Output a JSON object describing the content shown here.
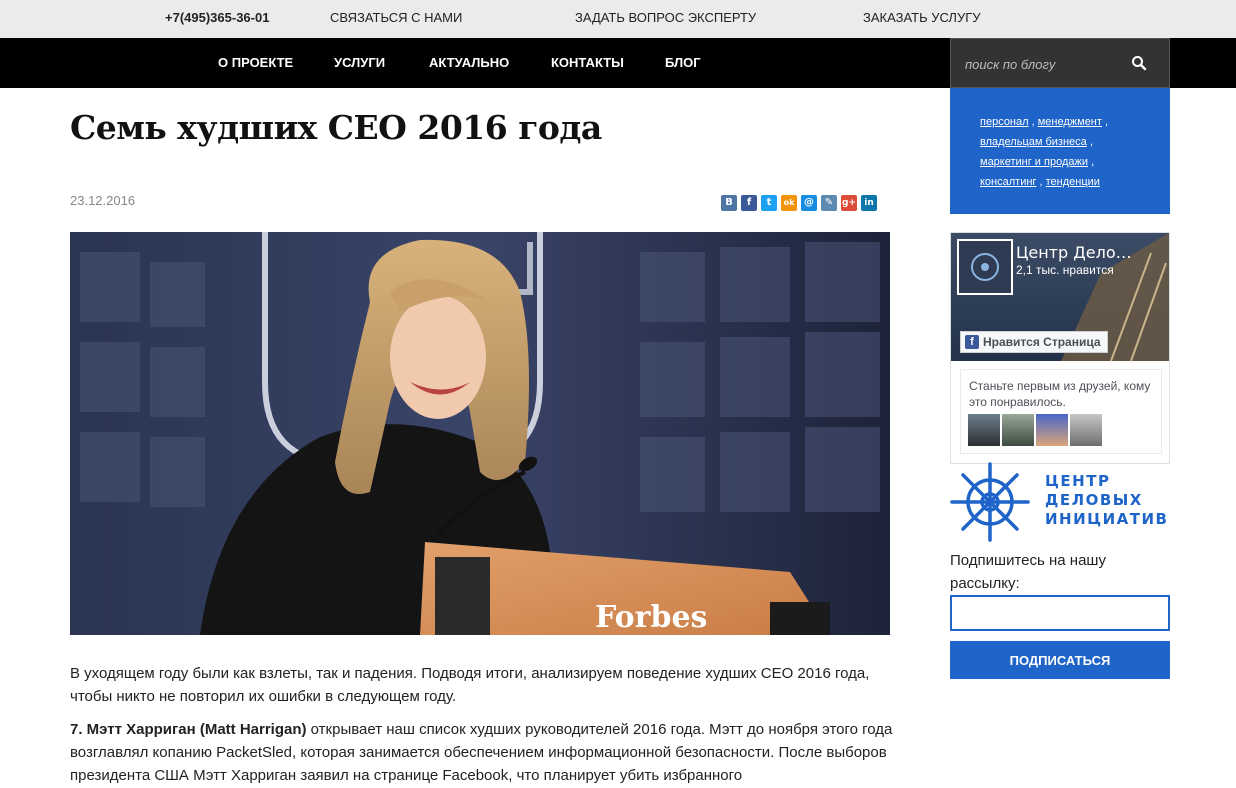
{
  "topbar": {
    "phone": "+7(495)365-36-01",
    "contact": "СВЯЗАТЬСЯ С НАМИ",
    "ask_expert": "ЗАДАТЬ ВОПРОС ЭКСПЕРТУ",
    "order_service": "ЗАКАЗАТЬ УСЛУГУ"
  },
  "nav": {
    "items": [
      "О ПРОЕКТЕ",
      "УСЛУГИ",
      "АКТУАЛЬНО",
      "КОНТАКТЫ",
      "БЛОГ"
    ]
  },
  "search": {
    "placeholder": "поиск по блогу",
    "icon": "search-icon"
  },
  "tags": [
    "персонал",
    "менеджмент",
    "владельцам бизнеса",
    "маркетинг и продажи",
    "консалтинг",
    "тенденции"
  ],
  "article": {
    "title": "Семь худших CEO 2016 года",
    "date": "23.12.2016",
    "share": [
      {
        "icon": "vk-icon",
        "glyph": "B",
        "color": "#4c75a3"
      },
      {
        "icon": "facebook-icon",
        "glyph": "f",
        "color": "#3b5998"
      },
      {
        "icon": "twitter-icon",
        "glyph": "t",
        "color": "#1da1f2"
      },
      {
        "icon": "odnoklassniki-icon",
        "glyph": "ok",
        "color": "#f2950c"
      },
      {
        "icon": "mail-icon",
        "glyph": "@",
        "color": "#168de2"
      },
      {
        "icon": "livejournal-icon",
        "glyph": "✎",
        "color": "#5e89b0"
      },
      {
        "icon": "google-plus-icon",
        "glyph": "g+",
        "color": "#dd4b39"
      },
      {
        "icon": "linkedin-icon",
        "glyph": "in",
        "color": "#0e76a8"
      }
    ],
    "intro": "В уходящем году были как взлеты, так и падения. Подводя итоги, анализируем поведение худших CEO 2016 года, чтобы никто не повторил их ошибки в следующем году.",
    "p2_bold": "7. Мэтт Харриган (Matt Harrigan)",
    "p2_text": " открывает наш список худших руководителей 2016 года. Мэтт до ноября этого года возглавлял копанию PacketSled, которая занимается обеспечением информационной безопасности. После выборов президента США Мэтт Харриган заявил на странице Facebook, что планирует убить избранного"
  },
  "facebook": {
    "page_name": "Центр Дело…",
    "likes": "2,1 тыс. нравится",
    "like_button": "Нравится Страница",
    "friends_text": "Станьте первым из друзей, кому это понравилось."
  },
  "logo": {
    "line1": "ЦЕНТР",
    "line2": "ДЕЛОВЫХ",
    "line3": "ИНИЦИАТИВ",
    "icon": "ship-wheel-icon"
  },
  "subscribe": {
    "label": "Подпишитесь на нашу рассылку:",
    "email_value": "",
    "button": "ПОДПИСАТЬСЯ"
  },
  "colors": {
    "accent": "#1f64c8",
    "nav_bg": "#000000",
    "topbar_bg": "#ebebeb"
  }
}
